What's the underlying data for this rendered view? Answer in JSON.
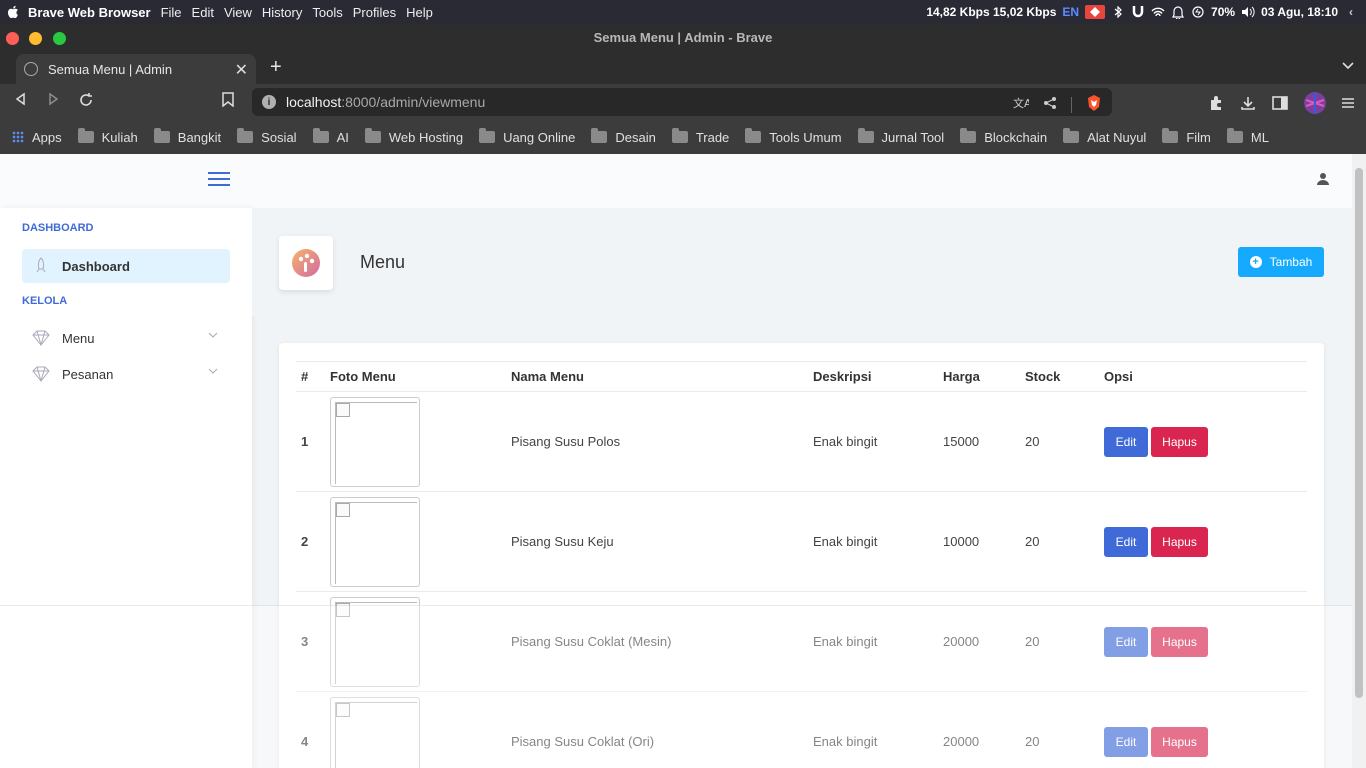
{
  "menubar": {
    "app_name": "Brave Web Browser",
    "items": [
      "File",
      "Edit",
      "View",
      "History",
      "Tools",
      "Profiles",
      "Help"
    ],
    "status": {
      "network": "14,82 Kbps 15,02 Kbps",
      "lang": "EN",
      "battery": "70%",
      "datetime": "03 Agu, 18:10"
    }
  },
  "window": {
    "title": "Semua Menu | Admin - Brave"
  },
  "tab": {
    "title": "Semua Menu | Admin"
  },
  "url": {
    "host": "localhost",
    "path": ":8000/admin/viewmenu"
  },
  "bookmarks": [
    "Apps",
    "Kuliah",
    "Bangkit",
    "Sosial",
    "AI",
    "Web Hosting",
    "Uang Online",
    "Desain",
    "Trade",
    "Tools Umum",
    "Jurnal Tool",
    "Blockchain",
    "Alat Nuyul",
    "Film",
    "ML"
  ],
  "sidebar": {
    "heading_dashboard": "DASHBOARD",
    "dashboard_label": "Dashboard",
    "heading_kelola": "KELOLA",
    "menu_label": "Menu",
    "pesanan_label": "Pesanan"
  },
  "page": {
    "title": "Menu",
    "add_button": "Tambah"
  },
  "table": {
    "headers": [
      "#",
      "Foto Menu",
      "Nama Menu",
      "Deskripsi",
      "Harga",
      "Stock",
      "Opsi"
    ],
    "rows": [
      {
        "no": "1",
        "nama": "Pisang Susu Polos",
        "deskripsi": "Enak bingit",
        "harga": "15000",
        "stock": "20"
      },
      {
        "no": "2",
        "nama": "Pisang Susu Keju",
        "deskripsi": "Enak bingit",
        "harga": "10000",
        "stock": "20"
      },
      {
        "no": "3",
        "nama": "Pisang Susu Coklat (Mesin)",
        "deskripsi": "Enak bingit",
        "harga": "20000",
        "stock": "20"
      },
      {
        "no": "4",
        "nama": "Pisang Susu Coklat (Ori)",
        "deskripsi": "Enak bingit",
        "harga": "20000",
        "stock": "20"
      }
    ],
    "edit_label": "Edit",
    "delete_label": "Hapus"
  },
  "colors": {
    "primary": "#3f6ad8",
    "info": "#16aaff",
    "danger": "#d92550",
    "active_bg": "#e0f3ff"
  }
}
